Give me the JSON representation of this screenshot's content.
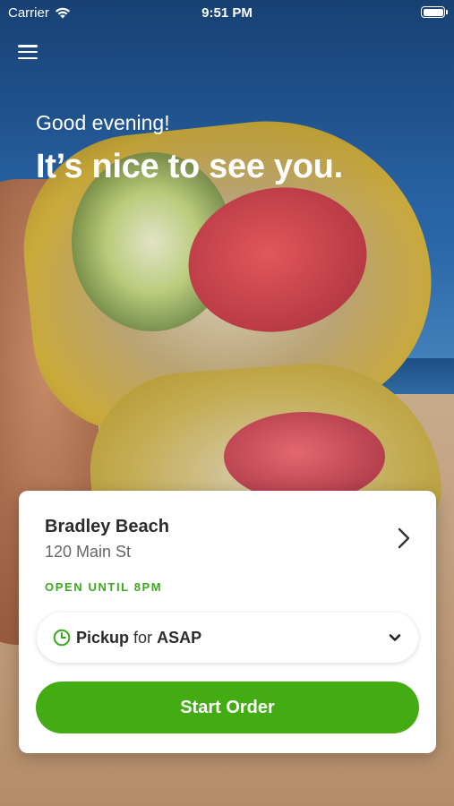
{
  "status_bar": {
    "carrier": "Carrier",
    "time": "9:51 PM"
  },
  "header": {
    "greeting": "Good evening!",
    "headline": "It’s nice to see you."
  },
  "location": {
    "name": "Bradley Beach",
    "address": "120 Main St",
    "hours": "OPEN UNTIL 8PM"
  },
  "order_mode": {
    "mode": "Pickup",
    "connector": "for",
    "time": "ASAP"
  },
  "actions": {
    "start_order": "Start Order"
  },
  "colors": {
    "accent": "#42ac12",
    "hours_text": "#3caa1e"
  },
  "icons": [
    "menu-icon",
    "wifi-icon",
    "battery-icon",
    "chevron-right-icon",
    "clock-icon",
    "chevron-down-icon"
  ]
}
